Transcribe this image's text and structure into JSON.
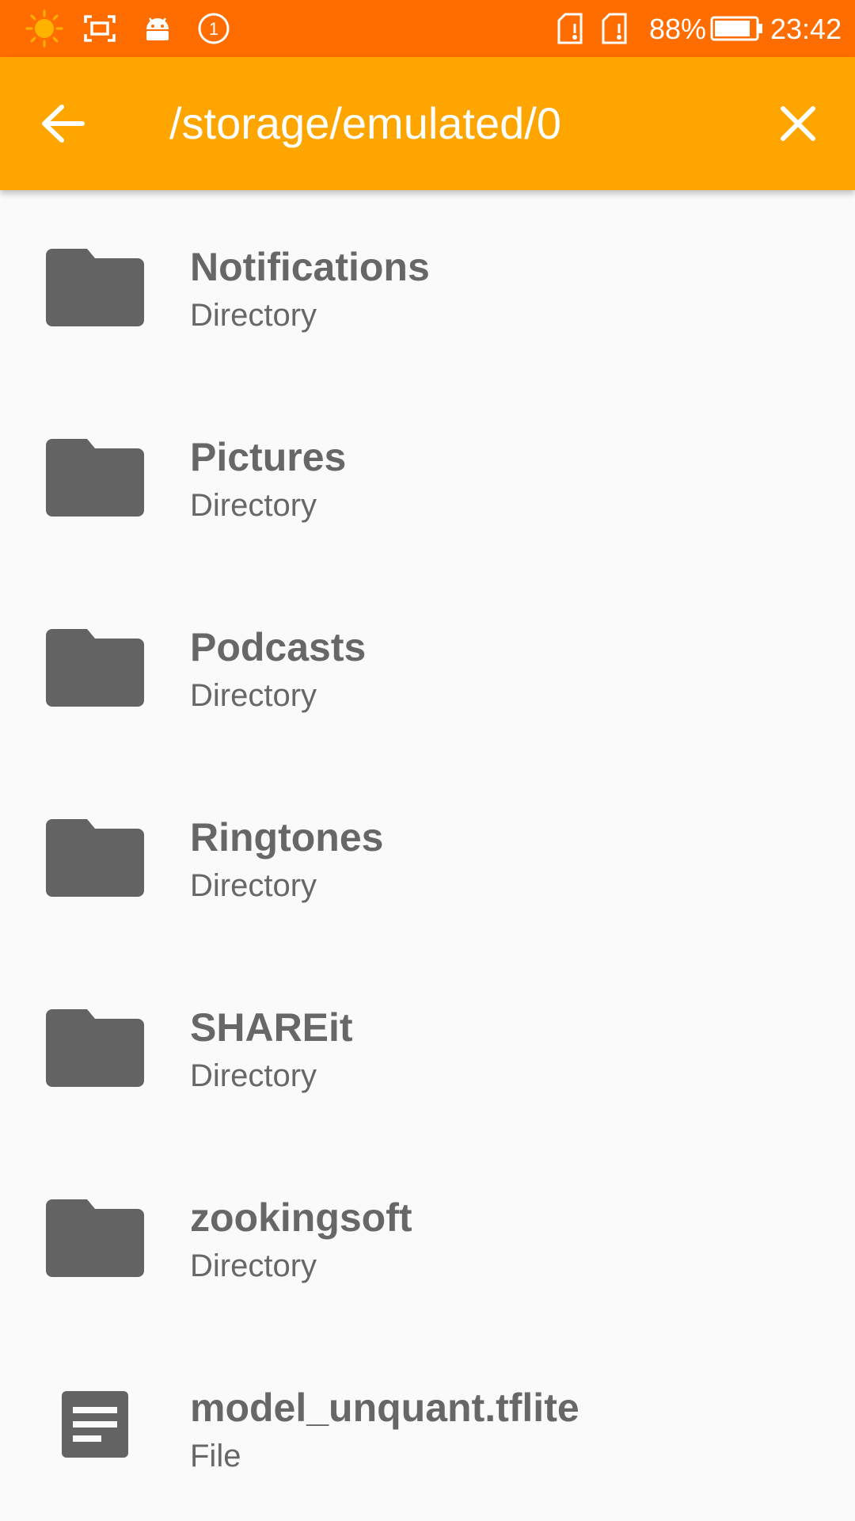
{
  "status_bar": {
    "icons": [
      "weather-sun-icon",
      "screenshot-icon",
      "android-icon",
      "notification-count-icon",
      "sim-card-icon",
      "sim-card-2-icon",
      "battery-icon"
    ],
    "notification_count": "1",
    "battery_percent": "88%",
    "battery_level": 0.88,
    "time": "23:42",
    "colors": {
      "background": "#ff6d00",
      "sun": "#ffb300"
    }
  },
  "app_bar": {
    "title": "/storage/emulated/0",
    "back_icon": "arrow-back-icon",
    "close_icon": "close-icon",
    "color": "#ffa500"
  },
  "files": [
    {
      "name": "Notifications",
      "type": "Directory",
      "icon": "folder-icon"
    },
    {
      "name": "Pictures",
      "type": "Directory",
      "icon": "folder-icon"
    },
    {
      "name": "Podcasts",
      "type": "Directory",
      "icon": "folder-icon"
    },
    {
      "name": "Ringtones",
      "type": "Directory",
      "icon": "folder-icon"
    },
    {
      "name": "SHAREit",
      "type": "Directory",
      "icon": "folder-icon"
    },
    {
      "name": "zookingsoft",
      "type": "Directory",
      "icon": "folder-icon"
    },
    {
      "name": "model_unquant.tflite",
      "type": "File",
      "icon": "file-document-icon"
    }
  ],
  "colors": {
    "icon": "#636363",
    "text": "#676767",
    "background": "#fafafa"
  }
}
